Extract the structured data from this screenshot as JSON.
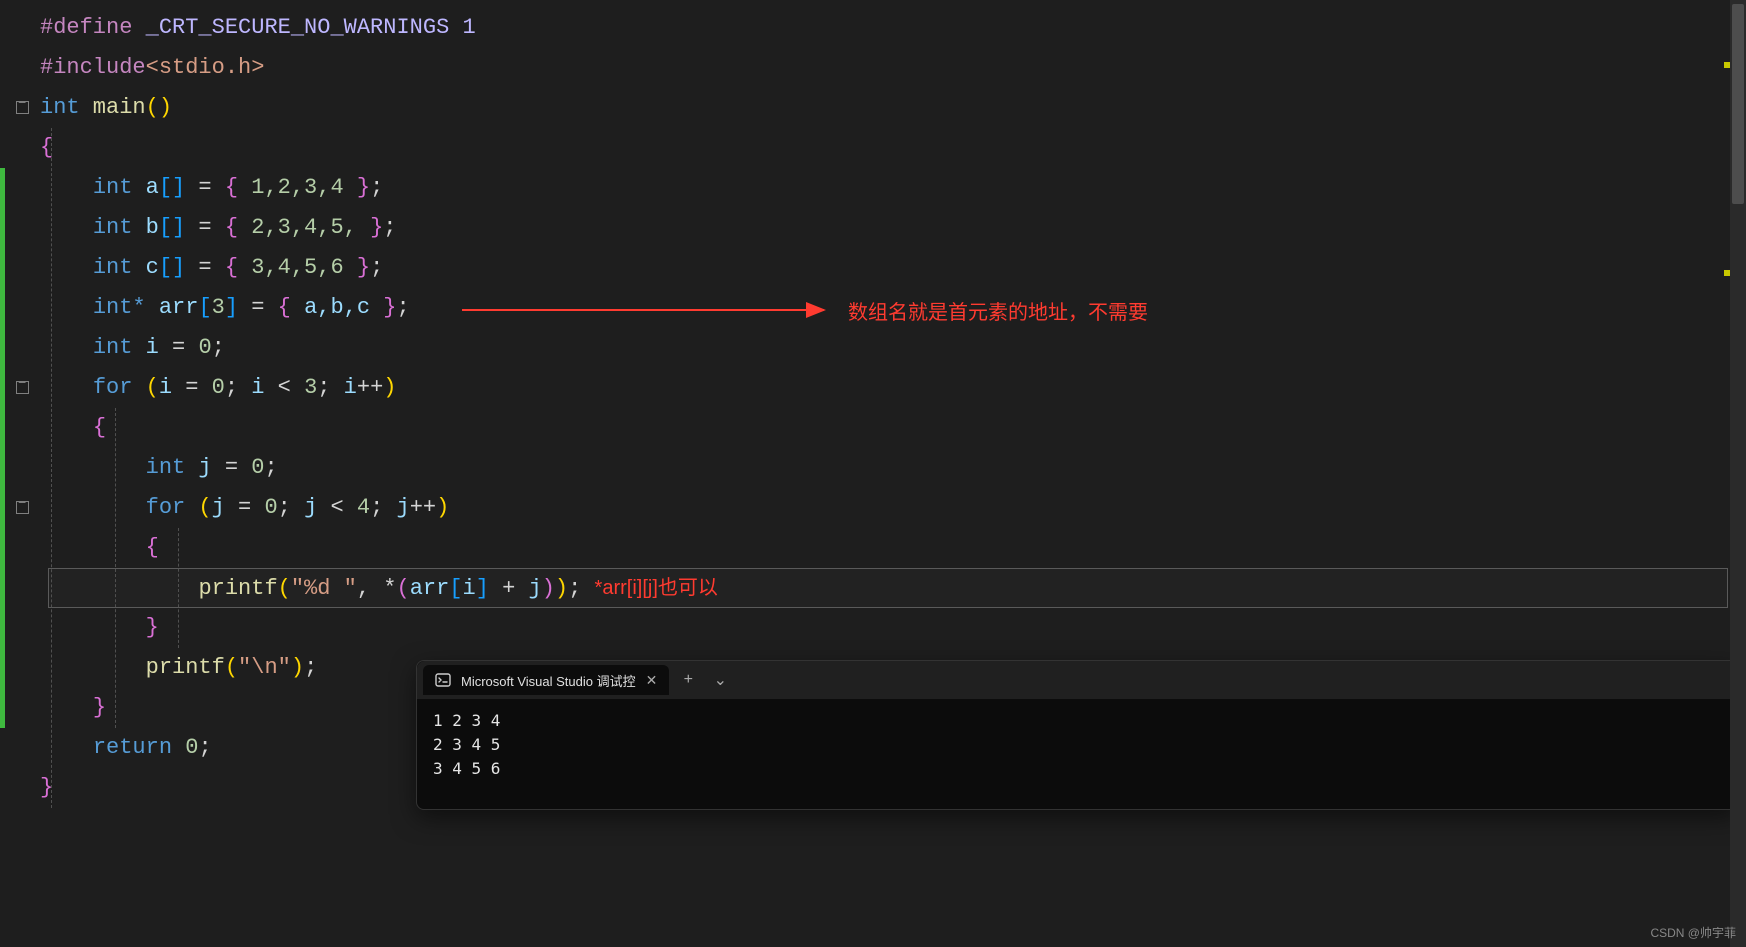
{
  "code": {
    "l1_define": "#define",
    "l1_macro": " _CRT_SECURE_NO_WARNINGS 1",
    "l2_include": "#include",
    "l2_hdr": "<stdio.h>",
    "l3_type": "int",
    "l3_main": " main",
    "l3_parens": "()",
    "l4_brace": "{",
    "l5_pre": "\t",
    "l5_int": "int",
    "l5_a": " a",
    "l5_br1": "[]",
    "l5_eq": " = ",
    "l5_open": "{ ",
    "l5_vals": "1,2,3,4",
    "l5_close": " }",
    "l5_semi": ";",
    "l6_b": " b",
    "l6_vals": "2,3,4,5,",
    "l7_c": " c",
    "l7_vals": "3,4,5,6",
    "l8_intstar": "int*",
    "l8_arr": " arr",
    "l8_br3": "[",
    "l8_three": "3",
    "l8_br3c": "]",
    "l8_eq": " = ",
    "l8_open": "{ ",
    "l8_abc": "a,b,c",
    "l8_close": " }",
    "l8_semi": ";",
    "l9_int": "int",
    "l9_i": " i",
    "l9_assign": " = ",
    "l9_zero": "0",
    "l9_semi": ";",
    "l10_for": "for",
    "l10_paren": " (",
    "l10_i": "i",
    "l10_assign": " = ",
    "l10_zero": "0",
    "l10_semi1": "; ",
    "l10_i2": "i",
    "l10_lt": " < ",
    "l10_three": "3",
    "l10_semi2": "; ",
    "l10_i3": "i",
    "l10_inc": "++",
    "l10_close": ")",
    "l11_brace": "{",
    "l12_int": "int",
    "l12_j": " j",
    "l12_assign": " = ",
    "l12_zero": "0",
    "l12_semi": ";",
    "l13_for": "for",
    "l13_paren": " (",
    "l13_j": "j",
    "l13_assign": " = ",
    "l13_zero": "0",
    "l13_semi1": "; ",
    "l13_j2": "j",
    "l13_lt": " < ",
    "l13_four": "4",
    "l13_semi2": "; ",
    "l13_j3": "j",
    "l13_inc": "++",
    "l13_close": ")",
    "l14_brace": "{",
    "l15_printf": "printf",
    "l15_paren": "(",
    "l15_fmt": "\"%d \"",
    "l15_comma": ", ",
    "l15_star": "*",
    "l15_p2": "(",
    "l15_arr": "arr",
    "l15_bro": "[",
    "l15_i": "i",
    "l15_brc": "]",
    "l15_plus": " + ",
    "l15_j": "j",
    "l15_p2c": ")",
    "l15_pc": ")",
    "l15_semi": ";",
    "l16_brace": "}",
    "l17_printf": "printf",
    "l17_paren": "(",
    "l17_nl": "\"\\n\"",
    "l17_pc": ")",
    "l17_semi": ";",
    "l18_brace": "}",
    "l19_return": "return",
    "l19_sp": " ",
    "l19_zero": "0",
    "l19_semi": ";",
    "l20_brace": "}"
  },
  "annotations": {
    "arr_comment": "数组名就是首元素的地址，不需要",
    "printf_comment": "*arr[i][j]也可以"
  },
  "terminal": {
    "tab_title": "Microsoft Visual Studio 调试控",
    "output_line1": "1 2 3 4",
    "output_line2": "2 3 4 5",
    "output_line3": "3 4 5 6"
  },
  "watermark": "CSDN @帅宇菲"
}
